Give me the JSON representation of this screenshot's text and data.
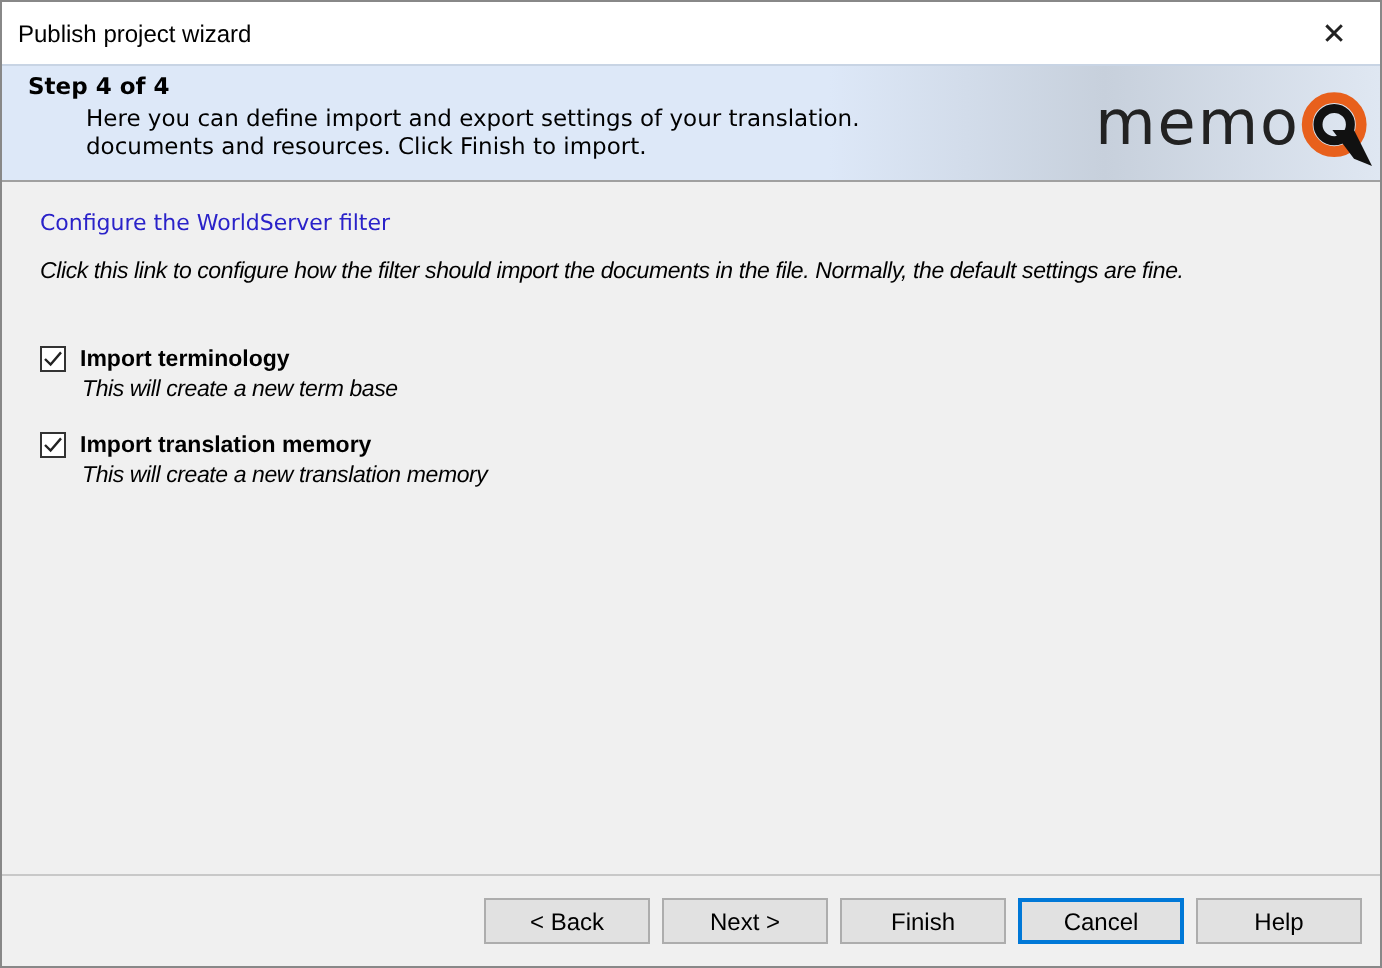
{
  "window": {
    "title": "Publish project wizard",
    "close": "✕"
  },
  "header": {
    "step": "Step 4 of 4",
    "description": "Here you can define import and export settings of your translation.\ndocuments and resources. Click Finish to import.",
    "logo_text": "memo"
  },
  "link": {
    "label": "Configure the WorldServer filter",
    "hint": "Click this link to configure how the filter should import the documents in the file. Normally, the default settings are fine."
  },
  "options": [
    {
      "label": "Import terminology",
      "description": "This will create a new term base",
      "checked": true
    },
    {
      "label": "Import translation memory",
      "description": "This will create a new translation memory",
      "checked": true
    }
  ],
  "buttons": [
    {
      "label": "< Back",
      "default": false
    },
    {
      "label": "Next >",
      "default": false
    },
    {
      "label": "Finish",
      "default": false
    },
    {
      "label": "Cancel",
      "default": true
    },
    {
      "label": "Help",
      "default": false
    }
  ]
}
